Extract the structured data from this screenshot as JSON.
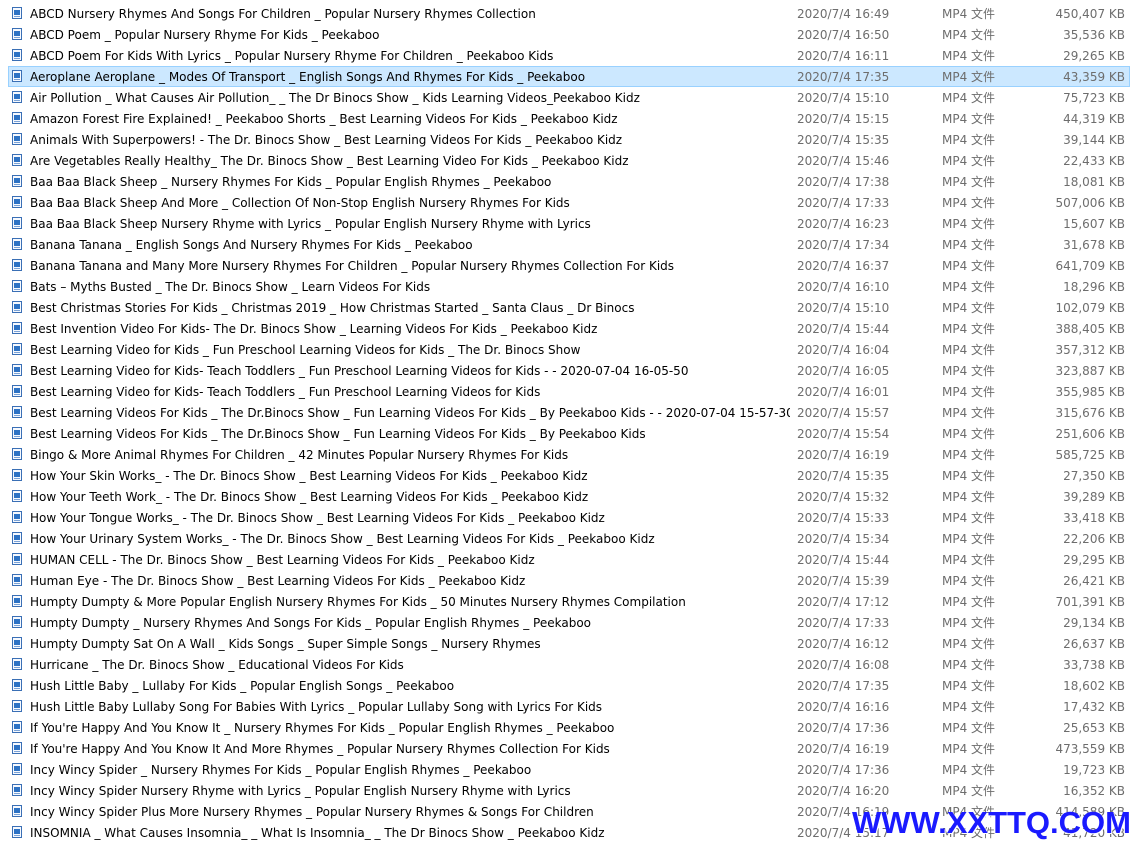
{
  "colors": {
    "selection_background": "#cce8ff",
    "selection_border": "#99d1ff",
    "meta_text": "#6d6d6d",
    "watermark": "#1a1aff"
  },
  "icon": "video-file-icon",
  "selected_index": 3,
  "files": [
    {
      "name": "ABCD Nursery Rhymes And Songs For Children _ Popular Nursery Rhymes Collection",
      "date": "2020/7/4 16:49",
      "type": "MP4 文件",
      "size": "450,407 KB"
    },
    {
      "name": "ABCD Poem _ Popular Nursery Rhyme For Kids _ Peekaboo",
      "date": "2020/7/4 16:50",
      "type": "MP4 文件",
      "size": "35,536 KB"
    },
    {
      "name": "ABCD Poem For Kids With Lyrics _ Popular Nursery Rhyme For Children _ Peekaboo Kids",
      "date": "2020/7/4 16:11",
      "type": "MP4 文件",
      "size": "29,265 KB"
    },
    {
      "name": "Aeroplane Aeroplane _ Modes Of Transport _ English Songs And Rhymes For Kids _ Peekaboo",
      "date": "2020/7/4 17:35",
      "type": "MP4 文件",
      "size": "43,359 KB"
    },
    {
      "name": "Air Pollution _ What Causes Air Pollution_ _ The Dr Binocs Show _ Kids Learning Videos_Peekaboo Kidz",
      "date": "2020/7/4 15:10",
      "type": "MP4 文件",
      "size": "75,723 KB"
    },
    {
      "name": "Amazon Forest Fire Explained! _ Peekaboo Shorts _ Best Learning Videos For Kids _ Peekaboo Kidz",
      "date": "2020/7/4 15:15",
      "type": "MP4 文件",
      "size": "44,319 KB"
    },
    {
      "name": "Animals With Superpowers! - The Dr. Binocs Show _ Best Learning Videos For Kids _ Peekaboo Kidz",
      "date": "2020/7/4 15:35",
      "type": "MP4 文件",
      "size": "39,144 KB"
    },
    {
      "name": "Are Vegetables Really Healthy_ The Dr. Binocs Show _ Best Learning Video For Kids _ Peekaboo Kidz",
      "date": "2020/7/4 15:46",
      "type": "MP4 文件",
      "size": "22,433 KB"
    },
    {
      "name": "Baa Baa Black Sheep _ Nursery Rhymes For Kids _ Popular English Rhymes _ Peekaboo",
      "date": "2020/7/4 17:38",
      "type": "MP4 文件",
      "size": "18,081 KB"
    },
    {
      "name": "Baa Baa Black Sheep And More _ Collection Of Non-Stop English Nursery Rhymes For Kids",
      "date": "2020/7/4 17:33",
      "type": "MP4 文件",
      "size": "507,006 KB"
    },
    {
      "name": "Baa Baa Black Sheep Nursery Rhyme with Lyrics _ Popular English Nursery Rhyme with Lyrics",
      "date": "2020/7/4 16:23",
      "type": "MP4 文件",
      "size": "15,607 KB"
    },
    {
      "name": "Banana Tanana _ English Songs And Nursery Rhymes For Kids _ Peekaboo",
      "date": "2020/7/4 17:34",
      "type": "MP4 文件",
      "size": "31,678 KB"
    },
    {
      "name": "Banana Tanana and Many More Nursery Rhymes For Children _ Popular Nursery Rhymes Collection For Kids",
      "date": "2020/7/4 16:37",
      "type": "MP4 文件",
      "size": "641,709 KB"
    },
    {
      "name": "Bats – Myths Busted _ The Dr. Binocs Show _ Learn Videos For Kids",
      "date": "2020/7/4 16:10",
      "type": "MP4 文件",
      "size": "18,296 KB"
    },
    {
      "name": "Best Christmas Stories For Kids _ Christmas 2019 _ How Christmas Started _ Santa Claus _ Dr Binocs",
      "date": "2020/7/4 15:10",
      "type": "MP4 文件",
      "size": "102,079 KB"
    },
    {
      "name": "Best Invention Video For Kids- The Dr. Binocs Show _ Learning Videos For Kids _ Peekaboo Kidz",
      "date": "2020/7/4 15:44",
      "type": "MP4 文件",
      "size": "388,405 KB"
    },
    {
      "name": "Best Learning Video for Kids _ Fun Preschool Learning Videos for Kids _ The Dr. Binocs Show",
      "date": "2020/7/4 16:04",
      "type": "MP4 文件",
      "size": "357,312 KB"
    },
    {
      "name": "Best Learning Video for Kids- Teach Toddlers _ Fun Preschool Learning Videos for Kids -  - 2020-07-04 16-05-50",
      "date": "2020/7/4 16:05",
      "type": "MP4 文件",
      "size": "323,887 KB"
    },
    {
      "name": "Best Learning Video for Kids- Teach Toddlers _ Fun Preschool Learning Videos for Kids",
      "date": "2020/7/4 16:01",
      "type": "MP4 文件",
      "size": "355,985 KB"
    },
    {
      "name": "Best Learning Videos For Kids _ The Dr.Binocs Show _ Fun Learning Videos For Kids _ By Peekaboo Kids -  - 2020-07-04 15-57-30",
      "date": "2020/7/4 15:57",
      "type": "MP4 文件",
      "size": "315,676 KB"
    },
    {
      "name": "Best Learning Videos For Kids _ The Dr.Binocs Show _ Fun Learning Videos For Kids _ By Peekaboo Kids",
      "date": "2020/7/4 15:54",
      "type": "MP4 文件",
      "size": "251,606 KB"
    },
    {
      "name": "Bingo & More Animal Rhymes For Children _ 42 Minutes Popular Nursery Rhymes For Kids",
      "date": "2020/7/4 16:19",
      "type": "MP4 文件",
      "size": "585,725 KB"
    },
    {
      "name": "How Your Skin Works_ - The Dr. Binocs Show _ Best Learning Videos For Kids _ Peekaboo Kidz",
      "date": "2020/7/4 15:35",
      "type": "MP4 文件",
      "size": "27,350 KB"
    },
    {
      "name": "How Your Teeth Work_ - The Dr. Binocs Show _ Best Learning Videos For Kids _ Peekaboo Kidz",
      "date": "2020/7/4 15:32",
      "type": "MP4 文件",
      "size": "39,289 KB"
    },
    {
      "name": "How Your Tongue Works_ - The Dr. Binocs Show _ Best Learning Videos For Kids _ Peekaboo Kidz",
      "date": "2020/7/4 15:33",
      "type": "MP4 文件",
      "size": "33,418 KB"
    },
    {
      "name": "How Your Urinary System Works_ - The Dr. Binocs Show _ Best Learning Videos For Kids _ Peekaboo Kidz",
      "date": "2020/7/4 15:34",
      "type": "MP4 文件",
      "size": "22,206 KB"
    },
    {
      "name": "HUMAN CELL - The Dr. Binocs Show _ Best Learning Videos For Kids _ Peekaboo Kidz",
      "date": "2020/7/4 15:44",
      "type": "MP4 文件",
      "size": "29,295 KB"
    },
    {
      "name": "Human Eye - The Dr. Binocs Show _ Best Learning Videos For Kids _ Peekaboo Kidz",
      "date": "2020/7/4 15:39",
      "type": "MP4 文件",
      "size": "26,421 KB"
    },
    {
      "name": "Humpty Dumpty & More Popular English Nursery Rhymes For Kids _ 50 Minutes Nursery Rhymes Compilation",
      "date": "2020/7/4 17:12",
      "type": "MP4 文件",
      "size": "701,391 KB"
    },
    {
      "name": "Humpty Dumpty _ Nursery Rhymes And Songs For Kids _ Popular English Rhymes _ Peekaboo",
      "date": "2020/7/4 17:33",
      "type": "MP4 文件",
      "size": "29,134 KB"
    },
    {
      "name": "Humpty Dumpty Sat On A Wall _ Kids Songs _ Super Simple Songs _ Nursery Rhymes",
      "date": "2020/7/4 16:12",
      "type": "MP4 文件",
      "size": "26,637 KB"
    },
    {
      "name": "Hurricane _ The Dr. Binocs Show _ Educational Videos For Kids",
      "date": "2020/7/4 16:08",
      "type": "MP4 文件",
      "size": "33,738 KB"
    },
    {
      "name": "Hush Little Baby _ Lullaby For Kids _ Popular English Songs _ Peekaboo",
      "date": "2020/7/4 17:35",
      "type": "MP4 文件",
      "size": "18,602 KB"
    },
    {
      "name": "Hush Little Baby Lullaby Song For Babies With Lyrics _ Popular Lullaby Song with Lyrics For Kids",
      "date": "2020/7/4 16:16",
      "type": "MP4 文件",
      "size": "17,432 KB"
    },
    {
      "name": "If You're Happy And You Know It _ Nursery Rhymes For Kids _ Popular English Rhymes _ Peekaboo",
      "date": "2020/7/4 17:36",
      "type": "MP4 文件",
      "size": "25,653 KB"
    },
    {
      "name": "If You're Happy And You Know It And More Rhymes _ Popular Nursery Rhymes Collection For Kids",
      "date": "2020/7/4 16:19",
      "type": "MP4 文件",
      "size": "473,559 KB"
    },
    {
      "name": "Incy Wincy Spider _ Nursery Rhymes For Kids _ Popular English Rhymes _ Peekaboo",
      "date": "2020/7/4 17:36",
      "type": "MP4 文件",
      "size": "19,723 KB"
    },
    {
      "name": "Incy Wincy Spider Nursery Rhyme with Lyrics _ Popular English Nursery Rhyme with Lyrics",
      "date": "2020/7/4 16:20",
      "type": "MP4 文件",
      "size": "16,352 KB"
    },
    {
      "name": "Incy Wincy Spider Plus More Nursery Rhymes _ Popular Nursery Rhymes & Songs For Children",
      "date": "2020/7/4 16:19",
      "type": "MP4 文件",
      "size": "414,589 KB"
    },
    {
      "name": "INSOMNIA _ What Causes Insomnia_ _ What Is Insomnia_ _ The Dr Binocs Show _ Peekaboo Kidz",
      "date": "2020/7/4 15:17",
      "type": "MP4 文件",
      "size": "41,720 KB"
    }
  ],
  "watermark": "WWW.XXTTQ.COM"
}
